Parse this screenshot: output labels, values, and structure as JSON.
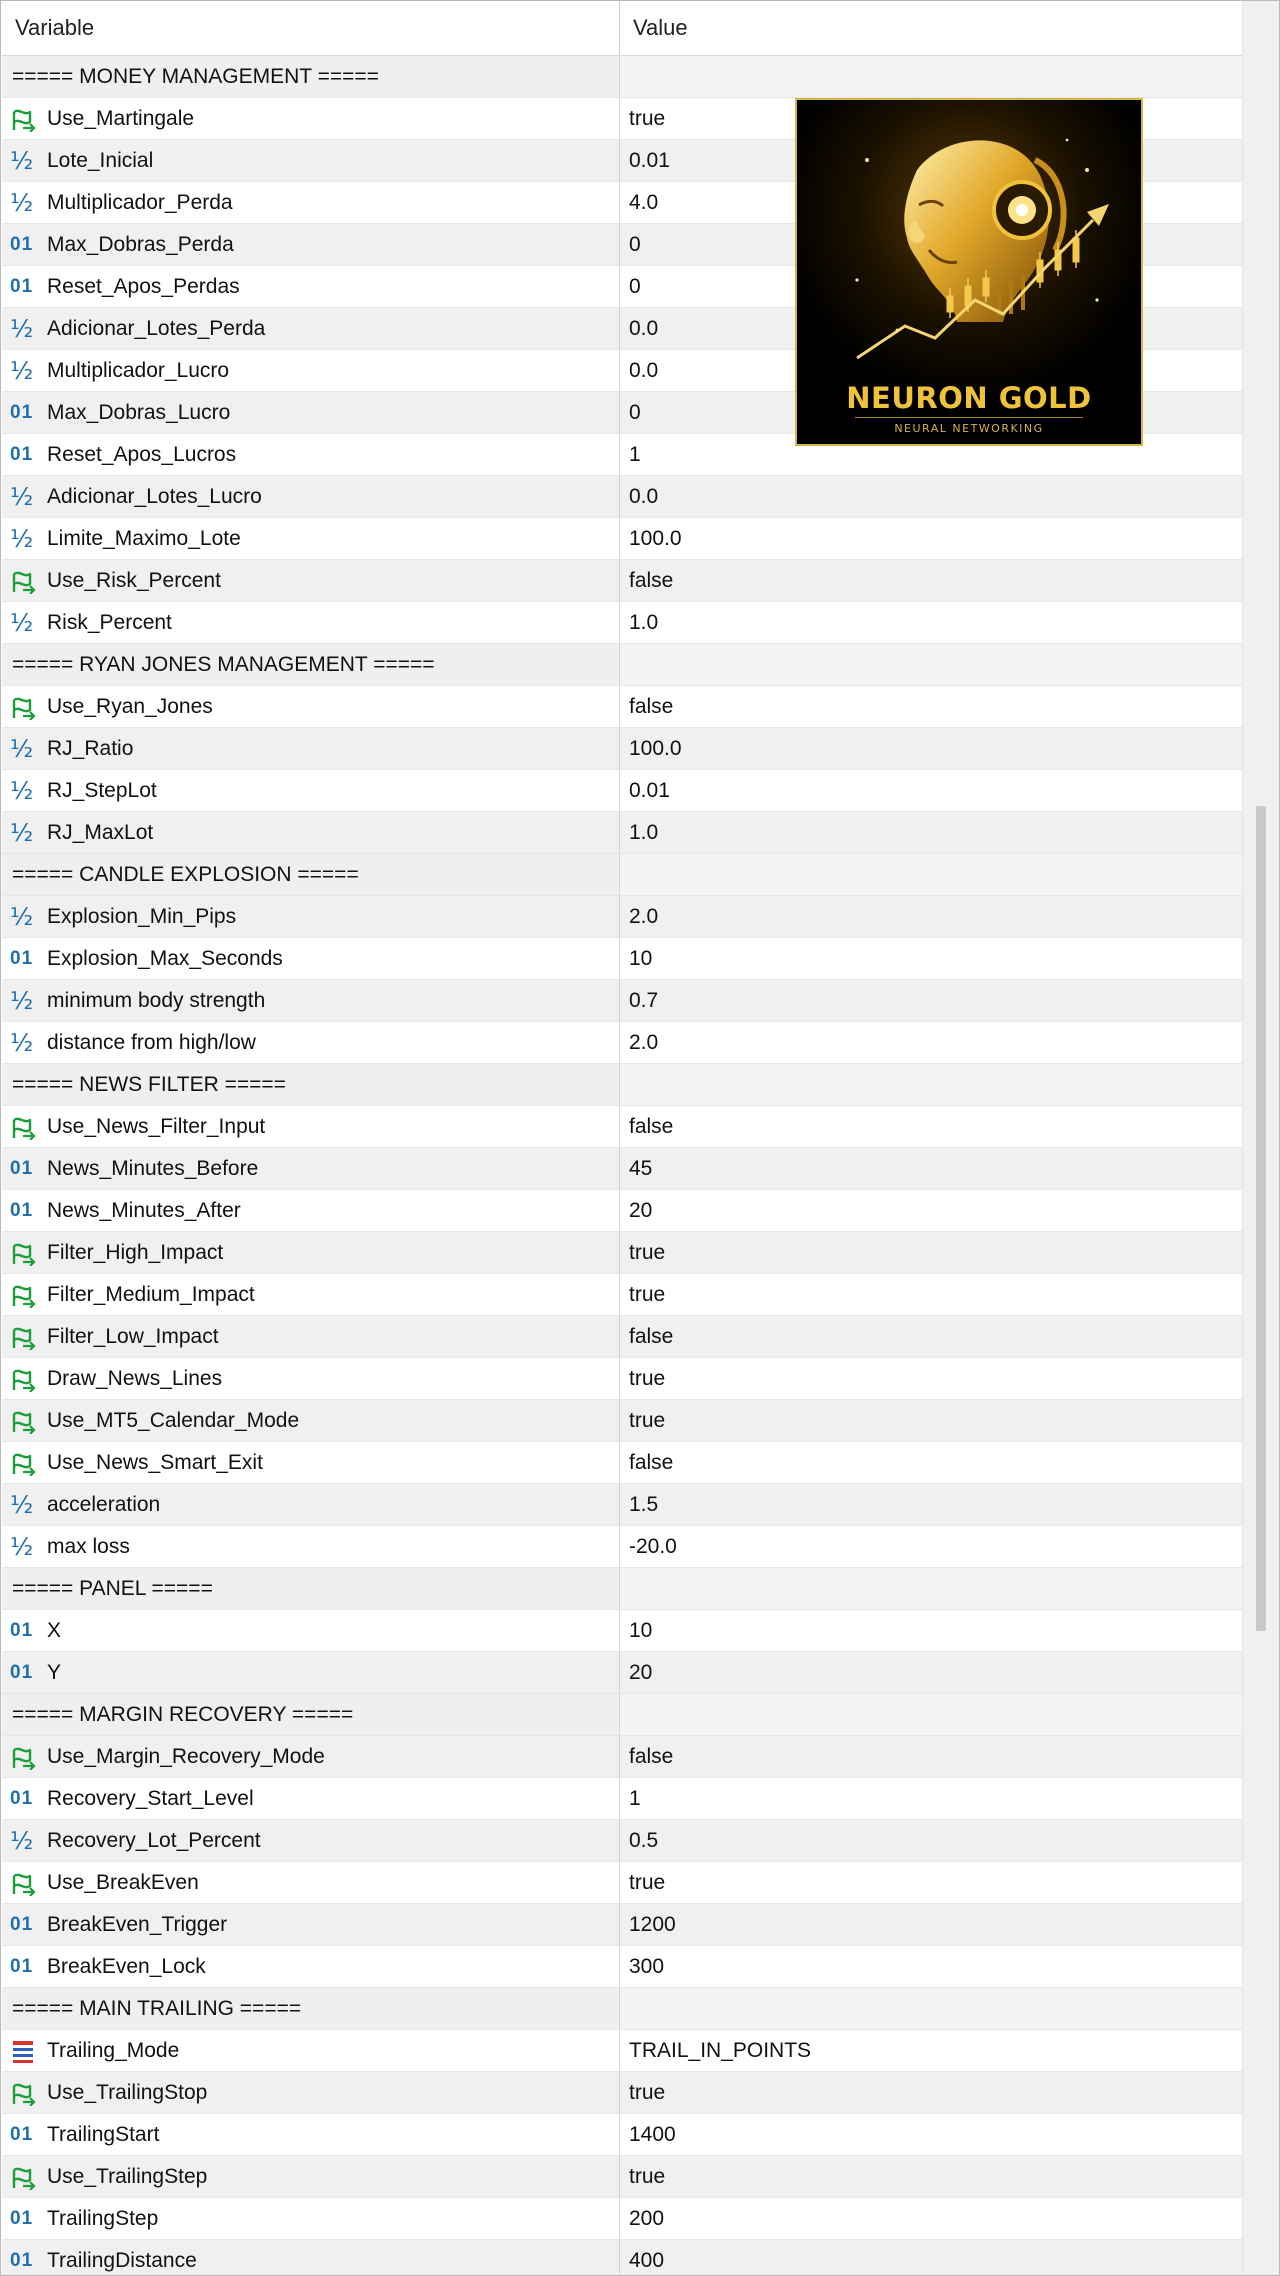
{
  "header": {
    "variable": "Variable",
    "value": "Value"
  },
  "logo": {
    "title": "NEURON GOLD",
    "subtitle": "NEURAL NETWORKING"
  },
  "rows": [
    {
      "type": "section",
      "name": "===== MONEY MANAGEMENT =====",
      "value": ""
    },
    {
      "type": "bool",
      "name": "Use_Martingale",
      "value": "true"
    },
    {
      "type": "double",
      "name": "Lote_Inicial",
      "value": "0.01"
    },
    {
      "type": "double",
      "name": "Multiplicador_Perda",
      "value": "4.0"
    },
    {
      "type": "int",
      "name": "Max_Dobras_Perda",
      "value": "0"
    },
    {
      "type": "int",
      "name": "Reset_Apos_Perdas",
      "value": "0"
    },
    {
      "type": "double",
      "name": "Adicionar_Lotes_Perda",
      "value": "0.0"
    },
    {
      "type": "double",
      "name": "Multiplicador_Lucro",
      "value": "0.0"
    },
    {
      "type": "int",
      "name": "Max_Dobras_Lucro",
      "value": "0"
    },
    {
      "type": "int",
      "name": "Reset_Apos_Lucros",
      "value": "1"
    },
    {
      "type": "double",
      "name": "Adicionar_Lotes_Lucro",
      "value": "0.0"
    },
    {
      "type": "double",
      "name": "Limite_Maximo_Lote",
      "value": "100.0"
    },
    {
      "type": "bool",
      "name": "Use_Risk_Percent",
      "value": "false"
    },
    {
      "type": "double",
      "name": "Risk_Percent",
      "value": "1.0"
    },
    {
      "type": "section",
      "name": "===== RYAN JONES MANAGEMENT =====",
      "value": ""
    },
    {
      "type": "bool",
      "name": "Use_Ryan_Jones",
      "value": "false"
    },
    {
      "type": "double",
      "name": "RJ_Ratio",
      "value": "100.0"
    },
    {
      "type": "double",
      "name": "RJ_StepLot",
      "value": "0.01"
    },
    {
      "type": "double",
      "name": "RJ_MaxLot",
      "value": "1.0"
    },
    {
      "type": "section",
      "name": "===== CANDLE EXPLOSION =====",
      "value": ""
    },
    {
      "type": "double",
      "name": "Explosion_Min_Pips",
      "value": "2.0"
    },
    {
      "type": "int",
      "name": "Explosion_Max_Seconds",
      "value": "10"
    },
    {
      "type": "double",
      "name": "minimum body strength",
      "value": "0.7"
    },
    {
      "type": "double",
      "name": "distance from high/low",
      "value": "2.0"
    },
    {
      "type": "section",
      "name": "===== NEWS FILTER =====",
      "value": ""
    },
    {
      "type": "bool",
      "name": "Use_News_Filter_Input",
      "value": "false"
    },
    {
      "type": "int",
      "name": "News_Minutes_Before",
      "value": "45"
    },
    {
      "type": "int",
      "name": "News_Minutes_After",
      "value": "20"
    },
    {
      "type": "bool",
      "name": "Filter_High_Impact",
      "value": "true"
    },
    {
      "type": "bool",
      "name": "Filter_Medium_Impact",
      "value": "true"
    },
    {
      "type": "bool",
      "name": "Filter_Low_Impact",
      "value": "false"
    },
    {
      "type": "bool",
      "name": "Draw_News_Lines",
      "value": "true"
    },
    {
      "type": "bool",
      "name": "Use_MT5_Calendar_Mode",
      "value": "true"
    },
    {
      "type": "bool",
      "name": "Use_News_Smart_Exit",
      "value": "false"
    },
    {
      "type": "double",
      "name": "acceleration",
      "value": "1.5"
    },
    {
      "type": "double",
      "name": "max loss",
      "value": "-20.0"
    },
    {
      "type": "section",
      "name": "===== PANEL =====",
      "value": ""
    },
    {
      "type": "int",
      "name": "X",
      "value": "10"
    },
    {
      "type": "int",
      "name": "Y",
      "value": "20"
    },
    {
      "type": "section",
      "name": "===== MARGIN RECOVERY =====",
      "value": ""
    },
    {
      "type": "bool",
      "name": "Use_Margin_Recovery_Mode",
      "value": "false"
    },
    {
      "type": "int",
      "name": "Recovery_Start_Level",
      "value": "1"
    },
    {
      "type": "double",
      "name": "Recovery_Lot_Percent",
      "value": "0.5"
    },
    {
      "type": "bool",
      "name": "Use_BreakEven",
      "value": "true"
    },
    {
      "type": "int",
      "name": "BreakEven_Trigger",
      "value": "1200"
    },
    {
      "type": "int",
      "name": "BreakEven_Lock",
      "value": "300"
    },
    {
      "type": "section",
      "name": "===== MAIN TRAILING =====",
      "value": ""
    },
    {
      "type": "enum",
      "name": "Trailing_Mode",
      "value": "TRAIL_IN_POINTS"
    },
    {
      "type": "bool",
      "name": "Use_TrailingStop",
      "value": "true"
    },
    {
      "type": "int",
      "name": "TrailingStart",
      "value": "1400"
    },
    {
      "type": "bool",
      "name": "Use_TrailingStep",
      "value": "true"
    },
    {
      "type": "int",
      "name": "TrailingStep",
      "value": "200"
    },
    {
      "type": "int",
      "name": "TrailingDistance",
      "value": "400"
    }
  ],
  "colors": {
    "bool_icon": "#1e9e3a",
    "number_icon": "#1f6fb0",
    "enum_icon_red": "#d8342c",
    "enum_icon_blue": "#2c5fb8",
    "logo_gold": "#f0c23a"
  },
  "icons": {
    "bool": "bool-type-icon",
    "double": "double-type-icon",
    "int": "int-type-icon",
    "enum": "enum-type-icon"
  }
}
